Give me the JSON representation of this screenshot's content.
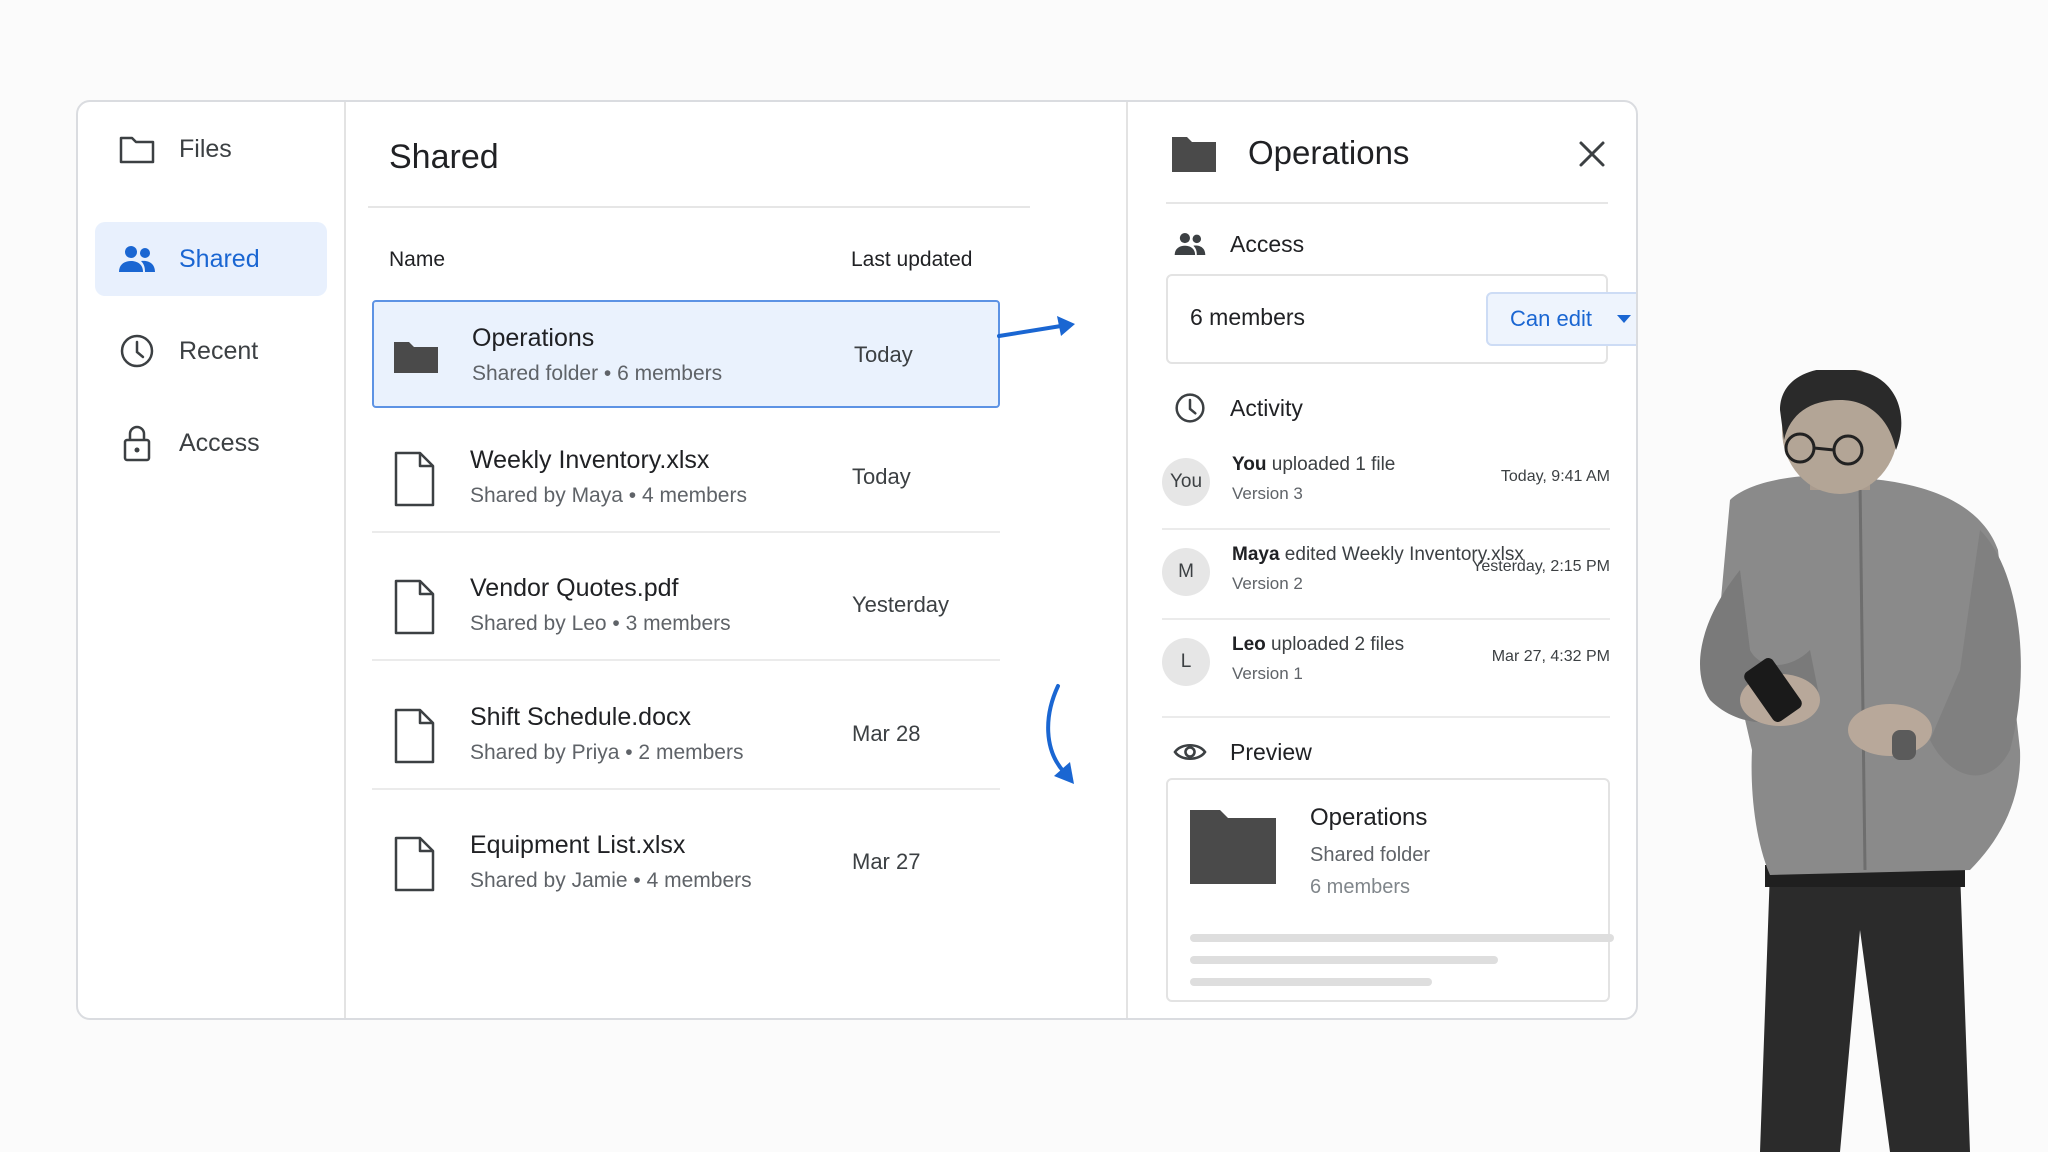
{
  "sidebar": {
    "items": [
      {
        "label": "Files",
        "icon": "folder-outline-icon",
        "active": false
      },
      {
        "label": "Shared",
        "icon": "people-icon",
        "active": true
      },
      {
        "label": "Recent",
        "icon": "clock-icon",
        "active": false
      },
      {
        "label": "Access",
        "icon": "lock-icon",
        "active": false
      }
    ]
  },
  "list": {
    "title": "Shared",
    "columns": {
      "name": "Name",
      "updated": "Last updated"
    },
    "rows": [
      {
        "name": "Operations",
        "meta": "Shared folder  •  6 members",
        "date": "Today",
        "type": "folder",
        "selected": true
      },
      {
        "name": "Weekly Inventory.xlsx",
        "meta": "Shared by Maya  •  4 members",
        "date": "Today",
        "type": "file",
        "selected": false
      },
      {
        "name": "Vendor Quotes.pdf",
        "meta": "Shared by Leo  •  3 members",
        "date": "Yesterday",
        "type": "file",
        "selected": false
      },
      {
        "name": "Shift Schedule.docx",
        "meta": "Shared by Priya  •  2 members",
        "date": "Mar 28",
        "type": "file",
        "selected": false
      },
      {
        "name": "Equipment List.xlsx",
        "meta": "Shared by Jamie  •  4 members",
        "date": "Mar 27",
        "type": "file",
        "selected": false
      }
    ]
  },
  "detail": {
    "title": "Operations",
    "access": {
      "label": "Access",
      "members": "6 members",
      "permission": "Can edit"
    },
    "activity": {
      "label": "Activity",
      "items": [
        {
          "avatar": "You",
          "actor": "You",
          "action": " uploaded 1 file",
          "version": "Version 3",
          "time": "Today, 9:41 AM"
        },
        {
          "avatar": "M",
          "actor": "Maya",
          "action": " edited Weekly Inventory.xlsx",
          "version": "Version 2",
          "time": "Yesterday, 2:15 PM"
        },
        {
          "avatar": "L",
          "actor": "Leo",
          "action": " uploaded 2 files",
          "version": "Version 1",
          "time": "Mar 27, 4:32 PM"
        }
      ]
    },
    "preview": {
      "label": "Preview",
      "name": "Operations",
      "subtitle": "Shared folder",
      "members": "6 members"
    }
  },
  "colors": {
    "accent": "#1a66d2",
    "selected_bg": "#eaf2fd",
    "folder_fill": "#4a4a4a"
  }
}
